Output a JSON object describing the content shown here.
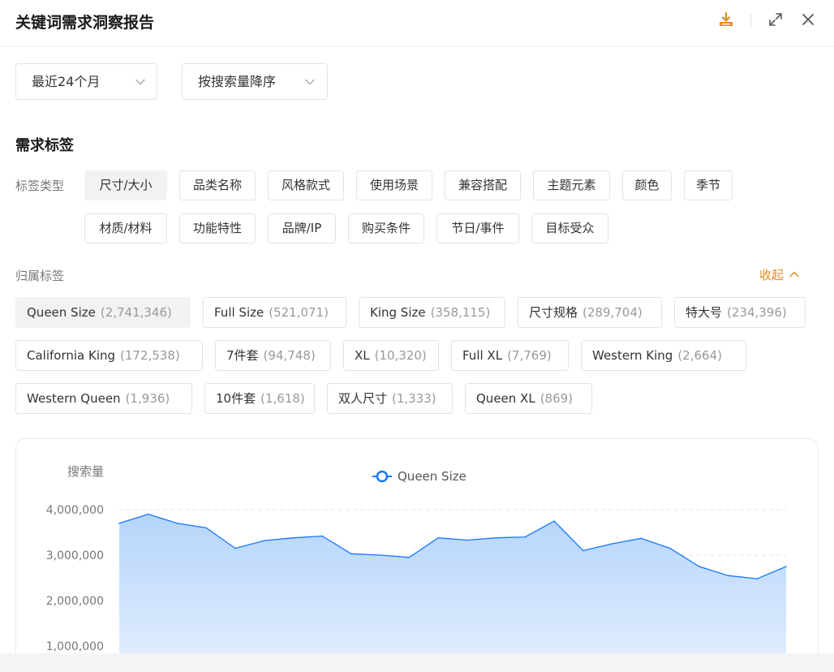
{
  "header": {
    "title": "关键词需求洞察报告",
    "accent_color": "#ea8a1c",
    "icons": [
      "download-icon",
      "expand-icon",
      "close-icon"
    ]
  },
  "filters": {
    "period": "最近24个月",
    "sort": "按搜索量降序"
  },
  "section_title": "需求标签",
  "tag_type": {
    "label": "标签类型",
    "active_index": 0,
    "items": [
      "尺寸/大小",
      "品类名称",
      "风格款式",
      "使用场景",
      "兼容搭配",
      "主题元素",
      "颜色",
      "季节",
      "材质/材料",
      "功能特性",
      "品牌/IP",
      "购买条件",
      "节日/事件",
      "目标受众"
    ]
  },
  "owned_tags": {
    "label": "归属标签",
    "collapse_label": "收起",
    "active_index": 0,
    "items": [
      {
        "name": "Queen Size",
        "count": "(2,741,346)"
      },
      {
        "name": "Full Size",
        "count": "(521,071)"
      },
      {
        "name": "King Size",
        "count": "(358,115)"
      },
      {
        "name": "尺寸规格",
        "count": "(289,704)"
      },
      {
        "name": "特大号",
        "count": "(234,396)"
      },
      {
        "name": "California King",
        "count": "(172,538)"
      },
      {
        "name": "7件套",
        "count": "(94,748)"
      },
      {
        "name": "XL",
        "count": "(10,320)"
      },
      {
        "name": "Full XL",
        "count": "(7,769)"
      },
      {
        "name": "Western King",
        "count": "(2,664)"
      },
      {
        "name": "Western Queen",
        "count": "(1,936)"
      },
      {
        "name": "10件套",
        "count": "(1,618)"
      },
      {
        "name": "双人尺寸",
        "count": "(1,333)"
      },
      {
        "name": "Queen XL",
        "count": "(869)"
      }
    ]
  },
  "chart_data": {
    "type": "area",
    "ylabel": "搜索量",
    "legend_position": "top-center",
    "series": [
      {
        "name": "Queen Size",
        "color": "#1677ff",
        "values": [
          3700000,
          3900000,
          3700000,
          3600000,
          3150000,
          3320000,
          3380000,
          3420000,
          3030000,
          3000000,
          2950000,
          3380000,
          3330000,
          3380000,
          3400000,
          3750000,
          3100000,
          3250000,
          3370000,
          3150000,
          2750000,
          2550000,
          2480000,
          2750000
        ]
      }
    ],
    "yticks": [
      "4,000,000",
      "3,000,000",
      "2,000,000",
      "1,000,000"
    ],
    "ytick_values": [
      4000000,
      3000000,
      2000000,
      1000000
    ],
    "grid": true
  }
}
